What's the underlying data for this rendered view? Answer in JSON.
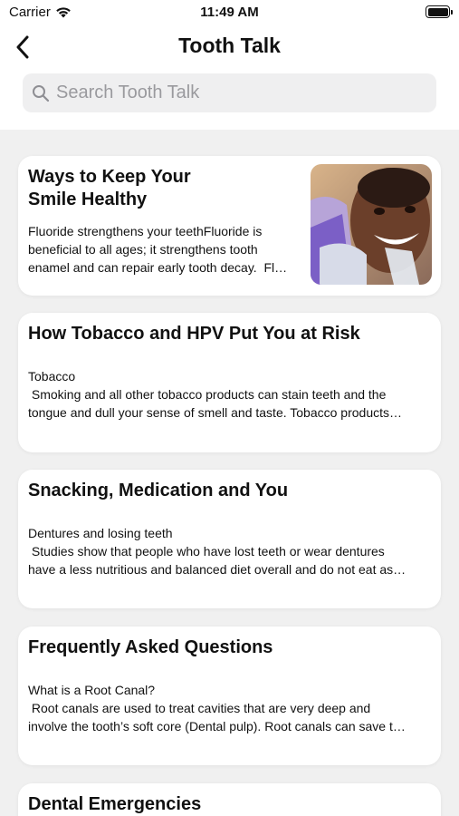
{
  "status_bar": {
    "carrier": "Carrier",
    "time": "11:49 AM"
  },
  "nav": {
    "title": "Tooth Talk",
    "back_icon": "chevron-left-icon"
  },
  "search": {
    "placeholder": "Search Tooth Talk",
    "value": ""
  },
  "articles": [
    {
      "title_lines": [
        "Ways to Keep Your",
        "Smile Healthy"
      ],
      "body_lines": [
        "Fluoride strengthens your teethFluoride is",
        "beneficial to all ages; it strengthens tooth",
        "enamel and can repair early tooth decay.  Fl…"
      ],
      "has_image": true,
      "image_icon": "smiling-child-at-dentist-image"
    },
    {
      "title_lines": [
        "How Tobacco and HPV Put You at Risk"
      ],
      "body_lines": [
        "Tobacco",
        " Smoking and all other tobacco products can stain teeth and the",
        "tongue and dull your sense of smell and taste. Tobacco products…"
      ],
      "has_image": false
    },
    {
      "title_lines": [
        "Snacking, Medication and You"
      ],
      "body_lines": [
        "Dentures and losing teeth",
        " Studies show that people who have lost teeth or wear dentures",
        "have a less nutritious and balanced diet overall and do not eat as…"
      ],
      "has_image": false
    },
    {
      "title_lines": [
        "Frequently Asked Questions"
      ],
      "body_lines": [
        "What is a Root Canal?",
        " Root canals are used to treat cavities that are very deep and",
        "involve the tooth’s soft core (Dental pulp). Root canals can save t…"
      ],
      "has_image": false
    },
    {
      "title_lines": [
        "Dental Emergencies"
      ],
      "body_lines": [],
      "has_image": false
    }
  ]
}
